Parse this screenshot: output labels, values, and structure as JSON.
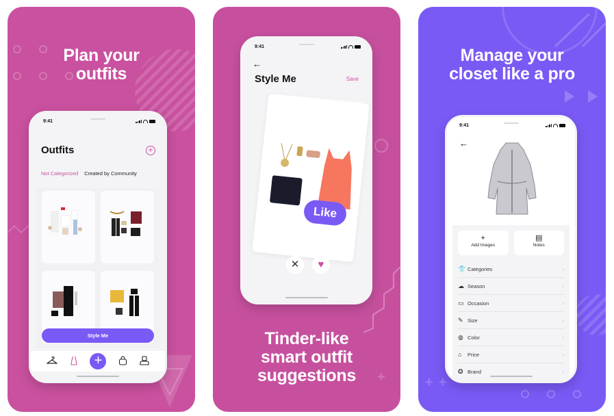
{
  "panels": [
    {
      "headline_line1": "Plan your",
      "headline_line2": "outfits",
      "background": "#c9519f",
      "phone": {
        "status_time": "9:41",
        "title": "Outfits",
        "add_icon": "plus-circle-icon",
        "tabs": [
          {
            "label": "Not Categorized",
            "active": true
          },
          {
            "label": "Created by Community",
            "active": false
          }
        ],
        "outfit_cards": [
          {
            "description": "White outfit with red heels, jeans and beige skirt"
          },
          {
            "description": "Black pants, burgundy top, gold necklace and black bag"
          },
          {
            "description": "Floral jacket with black dress"
          },
          {
            "description": "Yellow jacket with black jumpsuit and backpack"
          }
        ],
        "primary_button": "Style Me",
        "tab_bar": [
          "hanger-icon",
          "dress-icon",
          "plus-icon",
          "bag-icon",
          "profile-icon"
        ]
      }
    },
    {
      "headline_line1": "Tinder-like",
      "headline_line2": "smart outfit",
      "headline_line3": "suggestions",
      "background": "#c7509e",
      "phone": {
        "status_time": "9:41",
        "back_icon": "arrow-left-icon",
        "title": "Style Me",
        "save_label": "Save",
        "like_label": "Like",
        "dislike_icon": "x-icon",
        "like_icon": "heart-icon"
      }
    },
    {
      "headline_line1": "Manage your",
      "headline_line2": "closet like a pro",
      "background": "#7a5af5",
      "phone": {
        "status_time": "9:41",
        "back_icon": "arrow-left-icon",
        "actions": [
          {
            "label": "Add Images",
            "icon": "+"
          },
          {
            "label": "Notes",
            "icon": "▤"
          }
        ],
        "attributes": [
          {
            "label": "Categories",
            "icon": "👕"
          },
          {
            "label": "Season",
            "icon": "☁"
          },
          {
            "label": "Occasion",
            "icon": "▭"
          },
          {
            "label": "Size",
            "icon": "✎"
          },
          {
            "label": "Color",
            "icon": "◍"
          },
          {
            "label": "Price",
            "icon": "⌂"
          },
          {
            "label": "Brand",
            "icon": "✪"
          }
        ]
      }
    }
  ],
  "colors": {
    "pink": "#c9519f",
    "purple": "#7a5af5"
  }
}
